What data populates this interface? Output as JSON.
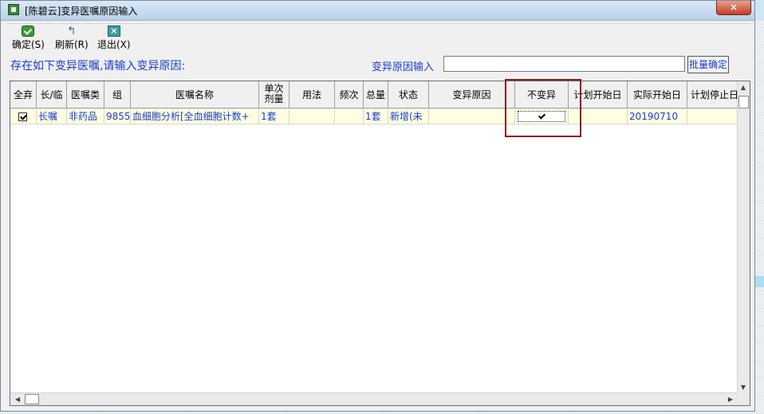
{
  "window": {
    "title": "[陈碧云]变异医嘱原因输入",
    "close_label": "×"
  },
  "toolbar": [
    {
      "label": "确定(S)"
    },
    {
      "label": "刷新(R)"
    },
    {
      "label": "退出(X)"
    }
  ],
  "prompt": "存在如下变异医嘱,请输入变异原因:",
  "reason": {
    "label": "变异原因输入",
    "value": "",
    "placeholder": ""
  },
  "batch_button": "批量确定",
  "table": {
    "headers": [
      "全弃",
      "长/临",
      "医嘱类",
      "组",
      "医嘱名称",
      "单次剂量",
      "用法",
      "频次",
      "总量",
      "状态",
      "变异原因",
      "不变异",
      "计划开始日",
      "实际开始日",
      "计划停止日"
    ],
    "header_lines": {
      "single_dose": [
        "单次",
        "剂量"
      ]
    },
    "rows": [
      {
        "discard": true,
        "type": "长嘱",
        "category": "非药品",
        "group": "9855",
        "name": "血细胞分析[全血细胞计数+",
        "dose": "1套",
        "usage": "",
        "freq": "",
        "total": "1套",
        "status": "新增(未",
        "reason": "",
        "no_variation": true,
        "plan_start": "",
        "actual_start": "20190710",
        "plan_stop": ""
      }
    ]
  },
  "colors": {
    "text_blue": "#1a3cd2",
    "row_yellow": "#ffffe1",
    "highlight": "#8b1a1a"
  }
}
